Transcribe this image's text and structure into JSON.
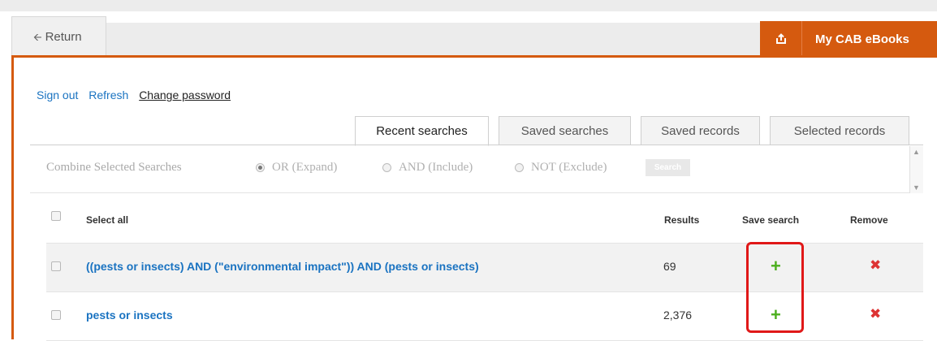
{
  "header": {
    "return_label": "Return",
    "return_icon": "arrow-left-icon",
    "cab_icon": "export-icon",
    "cab_label": "My CAB eBooks",
    "accent_color": "#d55a0f"
  },
  "links": {
    "sign_out": "Sign out",
    "refresh": "Refresh",
    "change_password": "Change password"
  },
  "tabs": [
    {
      "label": "Recent searches",
      "active": true
    },
    {
      "label": "Saved searches",
      "active": false
    },
    {
      "label": "Saved records",
      "active": false
    },
    {
      "label": "Selected records",
      "active": false
    }
  ],
  "combine": {
    "label": "Combine Selected Searches",
    "options": [
      {
        "label": "OR (Expand)",
        "checked": true
      },
      {
        "label": "AND (Include)",
        "checked": false
      },
      {
        "label": "NOT (Exclude)",
        "checked": false
      }
    ],
    "button": "Search"
  },
  "table": {
    "headers": {
      "select_all": "Select all",
      "results": "Results",
      "save": "Save search",
      "remove": "Remove"
    },
    "rows": [
      {
        "query": "((pests or insects) AND (\"environmental impact\")) AND (pests or insects)",
        "results": "69"
      },
      {
        "query": "pests or insects",
        "results": "2,376"
      }
    ],
    "save_symbol": "+",
    "remove_symbol": "✖",
    "save_color": "#4caf1e",
    "remove_color": "#dd3333"
  }
}
